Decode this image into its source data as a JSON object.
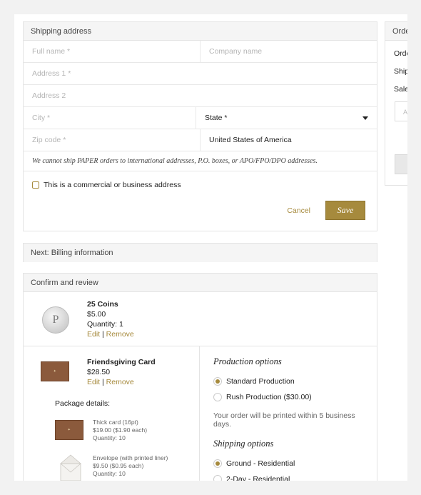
{
  "shipping": {
    "title": "Shipping address",
    "placeholders": {
      "full_name": "Full name *",
      "company": "Company name",
      "address1": "Address 1 *",
      "address2": "Address 2",
      "city": "City *",
      "zip": "Zip code *"
    },
    "state_label": "State *",
    "country": "United States of America",
    "notice": "We cannot ship PAPER orders to international addresses, P.O. boxes, or APO/FPO/DPO addresses.",
    "commercial_label": "This is a commercial or business address",
    "cancel_label": "Cancel",
    "save_label": "Save"
  },
  "billing": {
    "title": "Next: Billing information"
  },
  "review": {
    "title": "Confirm and review",
    "items": [
      {
        "name": "25 Coins",
        "price": "$5.00",
        "quantity": "Quantity: 1",
        "edit": "Edit",
        "sep": "|",
        "remove": "Remove",
        "image_text": "P"
      },
      {
        "name": "Friendsgiving Card",
        "price": "$28.50",
        "edit": "Edit",
        "sep": "|",
        "remove": "Remove"
      }
    ],
    "package_details_label": "Package details:",
    "package_items": [
      {
        "name": "Thick card (16pt)",
        "price": "$19.00 ($1.90 each)",
        "quantity": "Quantity: 10"
      },
      {
        "name": "Envelope (with printed liner)",
        "price": "$9.50 ($0.95 each)",
        "quantity": "Quantity: 10"
      }
    ],
    "production": {
      "title": "Production options",
      "options": [
        {
          "label": "Standard Production",
          "selected": true
        },
        {
          "label": "Rush Production ($30.00)",
          "selected": false
        }
      ],
      "note": "Your order will be printed within 5 business days."
    },
    "shipping_options": {
      "title": "Shipping options",
      "options": [
        {
          "label": "Ground - Residential",
          "selected": true
        },
        {
          "label": "2-Day - Residential",
          "selected": false
        }
      ]
    }
  },
  "summary": {
    "title": "Orde",
    "lines": [
      "Orde",
      "Ship",
      "Sale"
    ],
    "input_placeholder": "A"
  },
  "colors": {
    "accent": "#a68a3d",
    "panel_head": "#f5f5f5",
    "border": "#e4e4e4"
  }
}
